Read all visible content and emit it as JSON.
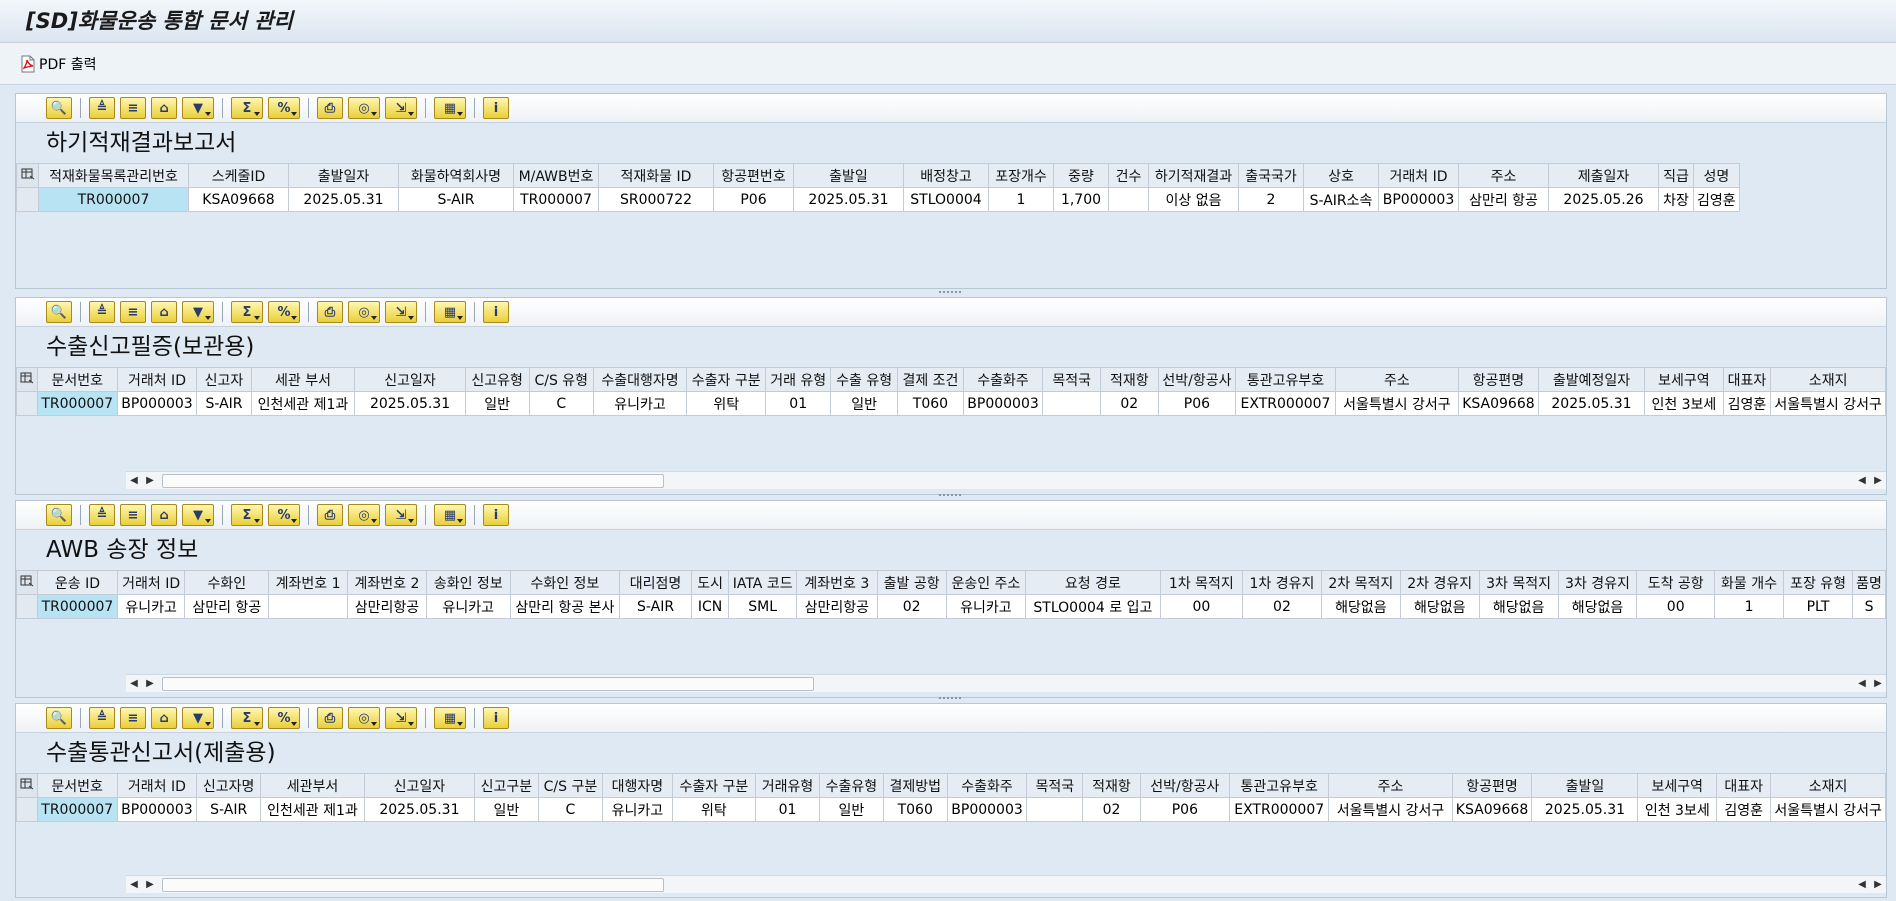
{
  "window": {
    "title": "[SD]화물운송 통합 문서 관리"
  },
  "appbar": {
    "pdf_label": "PDF 출력"
  },
  "colors": {
    "selected_cell": "#b8e3f3",
    "header_bg": "#e5ecf3",
    "panel_bg": "#dfe9f4"
  },
  "toolbar_icons": [
    "details-icon",
    "sort-ascending-icon",
    "sort-descending-icon",
    "find-icon",
    "filter-icon",
    "sum-icon",
    "subtotal-icon",
    "print-icon",
    "print-preview-icon",
    "export-icon",
    "layout-icon",
    "info-icon"
  ],
  "panel1": {
    "title": "하기적재결과보고서",
    "columns": [
      "적재화물목록관리번호",
      "스케줄ID",
      "출발일자",
      "화물하역회사명",
      "M/AWB번호",
      "적재화물 ID",
      "항공편번호",
      "출발일",
      "배정창고",
      "포장개수",
      "중량",
      "건수",
      "하기적재결과",
      "출국국가",
      "상호",
      "거래처 ID",
      "주소",
      "제출일자",
      "직급",
      "성명"
    ],
    "rows": [
      [
        "TR000007",
        "KSA09668",
        "2025.05.31",
        "S-AIR",
        "TR000007",
        "SR000722",
        "P06",
        "2025.05.31",
        "STLO0004",
        "1",
        "1,700",
        "",
        "이상 없음",
        "2",
        "S-AIR소속",
        "BP000003",
        "삼만리 항공",
        "2025.05.26",
        "차장",
        "김영훈"
      ]
    ]
  },
  "panel2": {
    "title": "수출신고필증(보관용)",
    "columns": [
      "문서번호",
      "거래처 ID",
      "신고자",
      "세관 부서",
      "신고일자",
      "신고유형",
      "C/S 유형",
      "수출대행자명",
      "수출자 구분",
      "거래 유형",
      "수출 유형",
      "결제 조건",
      "수출화주",
      "목적국",
      "적재항",
      "선박/항공사",
      "통관고유부호",
      "주소",
      "항공편명",
      "출발예정일자",
      "보세구역",
      "대표자",
      "소재지"
    ],
    "rows": [
      [
        "TR000007",
        "BP000003",
        "S-AIR",
        "인천세관 제1과",
        "2025.05.31",
        "일반",
        "C",
        "유니카고",
        "위탁",
        "01",
        "일반",
        "T060",
        "BP000003",
        "",
        "02",
        "P06",
        "EXTR000007",
        "서울특별시 강서구",
        "KSA09668",
        "2025.05.31",
        "인천 3보세",
        "김영훈",
        "서울특별시 강서구"
      ]
    ]
  },
  "panel3": {
    "title": "AWB 송장 정보",
    "columns": [
      "운송 ID",
      "거래처 ID",
      "수화인",
      "계좌번호 1",
      "계좌번호 2",
      "송화인 정보",
      "수화인 정보",
      "대리점명",
      "도시",
      "IATA 코드",
      "계좌번호 3",
      "출발 공항",
      "운송인 주소",
      "요청 경로",
      "1차 목적지",
      "1차 경유지",
      "2차 목적지",
      "2차 경유지",
      "3차 목적지",
      "3차 경유지",
      "도착 공항",
      "화물 개수",
      "포장 유형",
      "품명"
    ],
    "rows": [
      [
        "TR000007",
        "유니카고",
        "삼만리 항공",
        "",
        "삼만리항공",
        "유니카고",
        "삼만리 항공 본사",
        "S-AIR",
        "ICN",
        "SML",
        "삼만리항공",
        "02",
        "유니카고",
        "STLO0004 로 입고",
        "00",
        "02",
        "해당없음",
        "해당없음",
        "해당없음",
        "해당없음",
        "00",
        "1",
        "PLT",
        "S"
      ]
    ]
  },
  "panel4": {
    "title": "수출통관신고서(제출용)",
    "columns": [
      "문서번호",
      "거래처 ID",
      "신고자명",
      "세관부서",
      "신고일자",
      "신고구분",
      "C/S 구분",
      "대행자명",
      "수출자 구분",
      "거래유형",
      "수출유형",
      "결제방법",
      "수출화주",
      "목적국",
      "적재항",
      "선박/항공사",
      "통관고유부호",
      "주소",
      "항공편명",
      "출발일",
      "보세구역",
      "대표자",
      "소재지"
    ],
    "rows": [
      [
        "TR000007",
        "BP000003",
        "S-AIR",
        "인천세관 제1과",
        "2025.05.31",
        "일반",
        "C",
        "유니카고",
        "위탁",
        "01",
        "일반",
        "T060",
        "BP000003",
        "",
        "02",
        "P06",
        "EXTR000007",
        "서울특별시 강서구",
        "KSA09668",
        "2025.05.31",
        "인천 3보세",
        "김영훈",
        "서울특별시 강서구"
      ]
    ]
  }
}
